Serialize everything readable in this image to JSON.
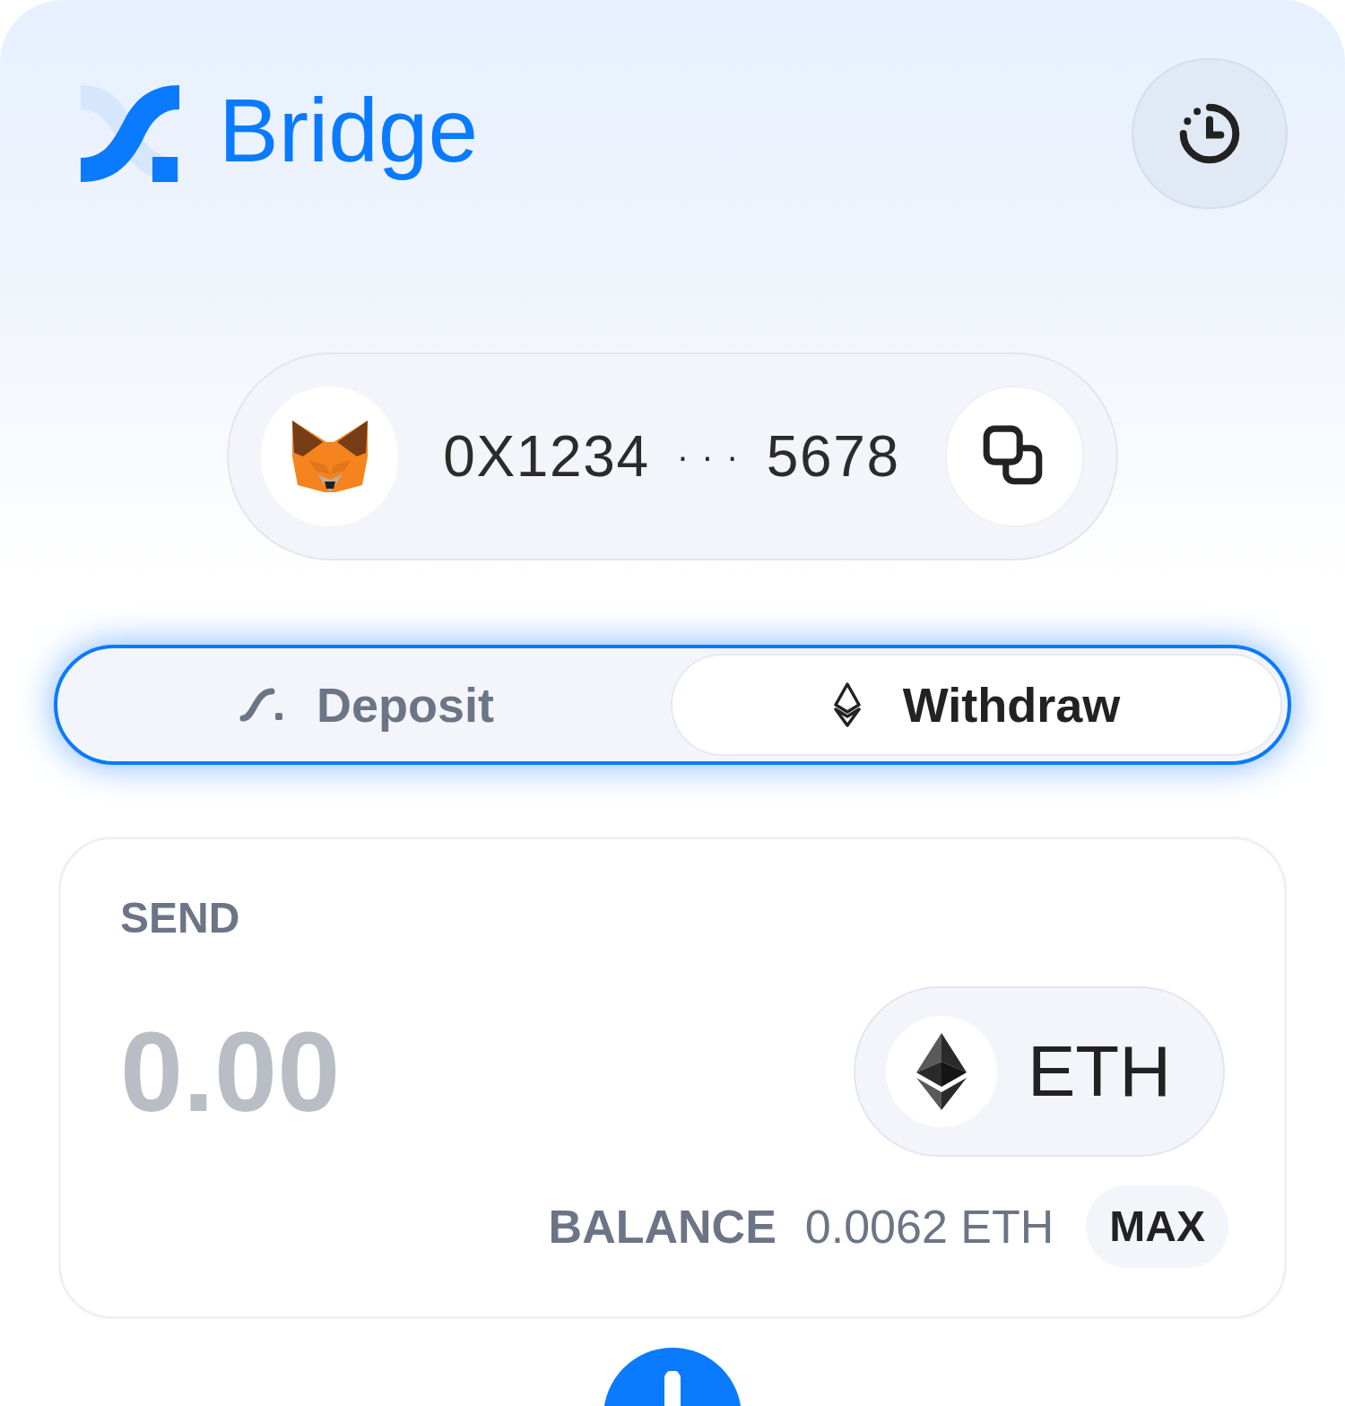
{
  "header": {
    "title": "Bridge"
  },
  "wallet": {
    "address_start": "0X1234",
    "separator": "· · ·",
    "address_end": "5678"
  },
  "tabs": [
    {
      "label": "Deposit",
      "kind": "deposit",
      "selected": false
    },
    {
      "label": "Withdraw",
      "kind": "withdraw",
      "selected": true
    }
  ],
  "send": {
    "label": "SEND",
    "amount": {
      "placeholder": "0.00"
    },
    "token": "ETH",
    "balance_label": "BALANCE",
    "balance": "0.0062 ETH",
    "max_button": "MAX"
  }
}
